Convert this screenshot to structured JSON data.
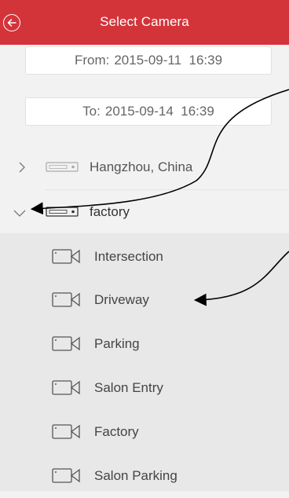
{
  "header": {
    "title": "Select Camera",
    "back_icon": "back-arrow-icon",
    "color": "#d3343a"
  },
  "date_range": {
    "from_label": "From:",
    "from_value": "2015-09-11  16:39",
    "to_label": "To:",
    "to_value": "2015-09-14  16:39"
  },
  "devices": [
    {
      "label": "Hangzhou, China",
      "expanded": false,
      "icon": "dvr-icon"
    },
    {
      "label": "factory",
      "expanded": true,
      "icon": "dvr-icon"
    }
  ],
  "cameras": [
    {
      "label": "Intersection",
      "icon": "camera-icon"
    },
    {
      "label": "Driveway",
      "icon": "camera-icon"
    },
    {
      "label": "Parking",
      "icon": "camera-icon"
    },
    {
      "label": "Salon Entry",
      "icon": "camera-icon"
    },
    {
      "label": "Factory",
      "icon": "camera-icon"
    },
    {
      "label": "Salon Parking",
      "icon": "camera-icon"
    }
  ]
}
